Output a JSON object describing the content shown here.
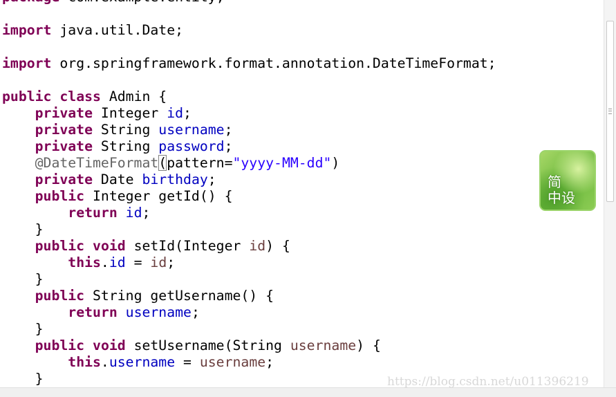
{
  "editor": {
    "lines": [
      [
        {
          "t": "package",
          "c": "kw"
        },
        {
          "t": " com.example.entity;",
          "c": ""
        }
      ],
      [],
      [
        {
          "t": "import",
          "c": "kw"
        },
        {
          "t": " java.util.Date;",
          "c": ""
        }
      ],
      [],
      [
        {
          "t": "import",
          "c": "kw"
        },
        {
          "t": " org.springframework.format.annotation.DateTimeFormat;",
          "c": ""
        }
      ],
      [],
      [
        {
          "t": "public",
          "c": "kw"
        },
        {
          "t": " ",
          "c": ""
        },
        {
          "t": "class",
          "c": "kw"
        },
        {
          "t": " Admin {",
          "c": ""
        }
      ],
      [
        {
          "t": "    ",
          "c": ""
        },
        {
          "t": "private",
          "c": "kw"
        },
        {
          "t": " Integer ",
          "c": ""
        },
        {
          "t": "id",
          "c": "fld"
        },
        {
          "t": ";",
          "c": ""
        }
      ],
      [
        {
          "t": "    ",
          "c": ""
        },
        {
          "t": "private",
          "c": "kw"
        },
        {
          "t": " String ",
          "c": ""
        },
        {
          "t": "username",
          "c": "fld"
        },
        {
          "t": ";",
          "c": ""
        }
      ],
      [
        {
          "t": "    ",
          "c": ""
        },
        {
          "t": "private",
          "c": "kw"
        },
        {
          "t": " String ",
          "c": ""
        },
        {
          "t": "password",
          "c": "fld"
        },
        {
          "t": ";",
          "c": ""
        }
      ],
      [
        {
          "t": "    ",
          "c": ""
        },
        {
          "t": "@DateTimeFormat",
          "c": "ann"
        },
        {
          "t": "(",
          "c": "bracket"
        },
        {
          "t": "pattern=",
          "c": ""
        },
        {
          "t": "\"yyyy-MM-dd\"",
          "c": "str"
        },
        {
          "t": ")",
          "c": ""
        }
      ],
      [
        {
          "t": "    ",
          "c": ""
        },
        {
          "t": "private",
          "c": "kw"
        },
        {
          "t": " Date ",
          "c": ""
        },
        {
          "t": "birthday",
          "c": "fld"
        },
        {
          "t": ";",
          "c": ""
        }
      ],
      [
        {
          "t": "    ",
          "c": ""
        },
        {
          "t": "public",
          "c": "kw"
        },
        {
          "t": " Integer getId() {",
          "c": ""
        }
      ],
      [
        {
          "t": "        ",
          "c": ""
        },
        {
          "t": "return",
          "c": "kw"
        },
        {
          "t": " ",
          "c": ""
        },
        {
          "t": "id",
          "c": "fld"
        },
        {
          "t": ";",
          "c": ""
        }
      ],
      [
        {
          "t": "    }",
          "c": ""
        }
      ],
      [
        {
          "t": "    ",
          "c": ""
        },
        {
          "t": "public",
          "c": "kw"
        },
        {
          "t": " ",
          "c": ""
        },
        {
          "t": "void",
          "c": "kw"
        },
        {
          "t": " setId(Integer ",
          "c": ""
        },
        {
          "t": "id",
          "c": "par"
        },
        {
          "t": ") {",
          "c": ""
        }
      ],
      [
        {
          "t": "        ",
          "c": ""
        },
        {
          "t": "this",
          "c": "kw"
        },
        {
          "t": ".",
          "c": ""
        },
        {
          "t": "id",
          "c": "fld"
        },
        {
          "t": " = ",
          "c": ""
        },
        {
          "t": "id",
          "c": "par"
        },
        {
          "t": ";",
          "c": ""
        }
      ],
      [
        {
          "t": "    }",
          "c": ""
        }
      ],
      [
        {
          "t": "    ",
          "c": ""
        },
        {
          "t": "public",
          "c": "kw"
        },
        {
          "t": " String getUsername() {",
          "c": ""
        }
      ],
      [
        {
          "t": "        ",
          "c": ""
        },
        {
          "t": "return",
          "c": "kw"
        },
        {
          "t": " ",
          "c": ""
        },
        {
          "t": "username",
          "c": "fld"
        },
        {
          "t": ";",
          "c": ""
        }
      ],
      [
        {
          "t": "    }",
          "c": ""
        }
      ],
      [
        {
          "t": "    ",
          "c": ""
        },
        {
          "t": "public",
          "c": "kw"
        },
        {
          "t": " ",
          "c": ""
        },
        {
          "t": "void",
          "c": "kw"
        },
        {
          "t": " setUsername(String ",
          "c": ""
        },
        {
          "t": "username",
          "c": "par"
        },
        {
          "t": ") {",
          "c": ""
        }
      ],
      [
        {
          "t": "        ",
          "c": ""
        },
        {
          "t": "this",
          "c": "kw"
        },
        {
          "t": ".",
          "c": ""
        },
        {
          "t": "username",
          "c": "fld"
        },
        {
          "t": " = ",
          "c": ""
        },
        {
          "t": "username",
          "c": "par"
        },
        {
          "t": ";",
          "c": ""
        }
      ],
      [
        {
          "t": "    }",
          "c": ""
        }
      ]
    ],
    "current_line": 10
  },
  "badge": {
    "text": "简\n中设"
  },
  "watermark": {
    "text": "https://blog.csdn.net/u011396219"
  },
  "colors": {
    "keyword": "#7f0055",
    "field": "#0000c0",
    "parameter": "#6a3e3e",
    "annotation": "#646464",
    "string": "#2a00ff",
    "current_line_bg": "#e8f2fe"
  },
  "icons": {
    "badge": "green-leaf-logo-icon"
  }
}
